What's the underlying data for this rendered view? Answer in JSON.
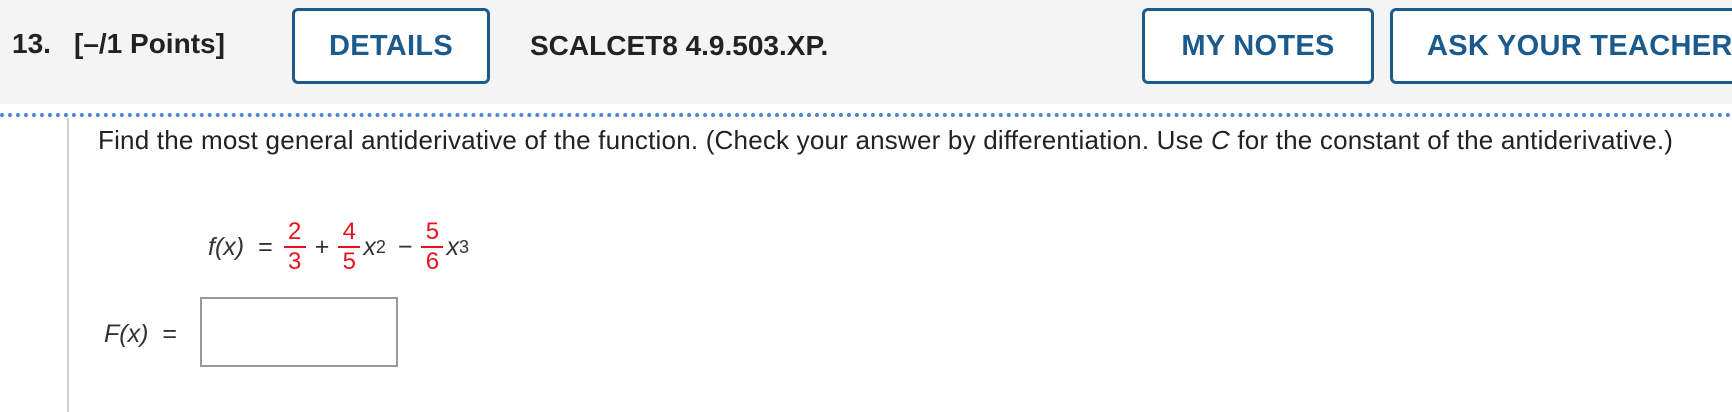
{
  "header": {
    "number": "13.",
    "points": "[–/1 Points]",
    "details_label": "DETAILS",
    "code": "SCALCET8 4.9.503.XP.",
    "my_notes_label": "MY NOTES",
    "ask_label": "ASK YOUR TEACHER"
  },
  "question": {
    "text_before": "Find the most general antiderivative of the function. (Check your answer by differentiation. Use ",
    "constant_symbol": "C",
    "text_after": " for the constant of the antiderivative.)"
  },
  "formula": {
    "lhs": "f(x)",
    "equals": "=",
    "frac1": {
      "num": "2",
      "den": "3"
    },
    "plus": "+",
    "frac2": {
      "num": "4",
      "den": "5"
    },
    "term2_var": "x",
    "term2_exp": "2",
    "minus": "−",
    "frac3": {
      "num": "5",
      "den": "6"
    },
    "term3_var": "x",
    "term3_exp": "3"
  },
  "answer": {
    "label": "F(x)",
    "equals": "=",
    "value": ""
  },
  "colors": {
    "accent": "#1a5a8c",
    "fraction": "#e8121e",
    "dotted_rule": "#4c86d6"
  }
}
